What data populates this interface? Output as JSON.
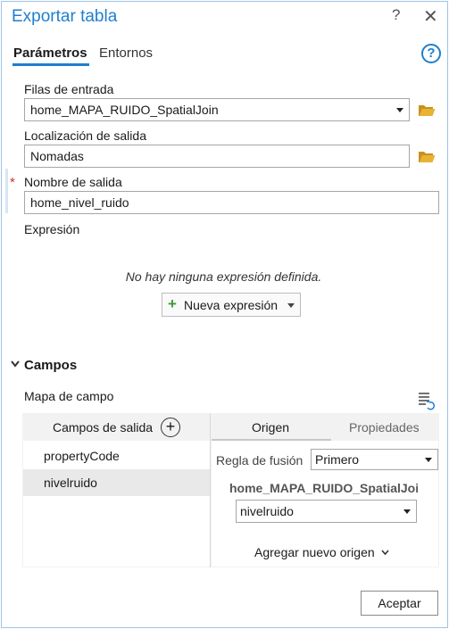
{
  "window": {
    "title": "Exportar tabla",
    "help_glyph": "?",
    "close_glyph": "✕"
  },
  "tabs": {
    "parameters": "Parámetros",
    "environments": "Entornos",
    "help_glyph": "?"
  },
  "form": {
    "input_rows_label": "Filas de entrada",
    "input_rows_value": "home_MAPA_RUIDO_SpatialJoin",
    "output_location_label": "Localización de salida",
    "output_location_value": "Nomadas",
    "output_name_label": "Nombre de salida",
    "output_name_value": "home_nivel_ruido",
    "required_marker": "*",
    "expression_label": "Expresión",
    "no_expression_text": "No hay ninguna expresión definida.",
    "new_expression_label": "Nueva expresión",
    "new_expression_plus": "+"
  },
  "fields_section": {
    "title": "Campos",
    "field_map_label": "Mapa de campo",
    "output_fields_header": "Campos de salida",
    "add_glyph": "+",
    "tab_origin": "Origen",
    "tab_properties": "Propiedades",
    "output_fields": [
      "propertyCode",
      "nivelruido"
    ],
    "merge_rule_label": "Regla de fusión",
    "merge_rule_value": "Primero",
    "source_table": "home_MAPA_RUIDO_SpatialJoin",
    "source_field_value": "nivelruido",
    "add_source_label": "Agregar nuevo origen"
  },
  "footer": {
    "accept_label": "Aceptar"
  },
  "colors": {
    "accent": "#1e7fcf",
    "folder": "#e8b233",
    "required": "#c0392b",
    "plus": "#3a9b35"
  }
}
